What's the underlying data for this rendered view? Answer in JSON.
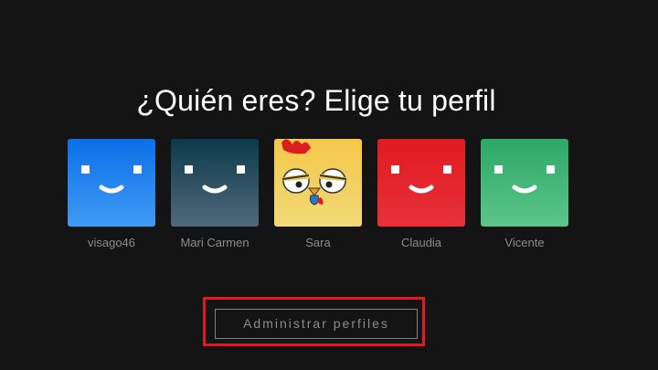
{
  "heading": "¿Quién eres? Elige tu perfil",
  "profiles": [
    {
      "name": "visago46",
      "icon": "smiley-face-icon",
      "color_top": "#0d6fe8",
      "color_bottom": "#3f9bf5"
    },
    {
      "name": "Mari Carmen",
      "icon": "smiley-face-icon",
      "color_top": "#0b3a4a",
      "color_bottom": "#51697a"
    },
    {
      "name": "Sara",
      "icon": "cartoon-chicken-icon",
      "color_top": "#f5c84a",
      "color_bottom": "#f1d977"
    },
    {
      "name": "Claudia",
      "icon": "smiley-face-icon",
      "color_top": "#e01b22",
      "color_bottom": "#e83038"
    },
    {
      "name": "Vicente",
      "icon": "smiley-face-icon",
      "color_top": "#2da865",
      "color_bottom": "#5cc58b"
    }
  ],
  "manage_button": {
    "label": "Administrar perfiles",
    "highlight_color": "#e21b23"
  },
  "colors": {
    "background": "#141414",
    "heading": "#ffffff",
    "secondary_text": "#8c8c8c"
  }
}
